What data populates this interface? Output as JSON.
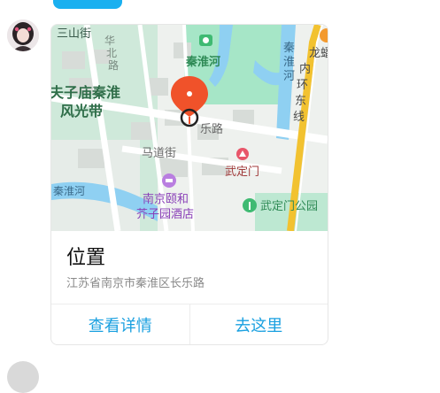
{
  "map": {
    "labels": {
      "sanshanjie": "三山街",
      "huabei": "华",
      "huabei2": "北",
      "huabei3": "路",
      "qinhuaihe_top": "秦淮河",
      "qinhuaihe_right1": "秦",
      "qinhuaihe_right2": "淮",
      "qinhuaihe_right3": "河",
      "huancheng1": "内",
      "huancheng2": "环",
      "huancheng3": "东",
      "huancheng4": "线",
      "longpan": "龙蟠",
      "fuzimiao1": "夫子庙秦淮",
      "fuzimiao2": "风光带",
      "lelu": "乐路",
      "madaojie": "马道街",
      "wudingmen": "武定门",
      "qinhuaihe_left": "秦淮河",
      "hotel1": "南京颐和",
      "hotel2": "芥子园酒店",
      "wudingmen_park": "武定门公园"
    }
  },
  "location": {
    "title": "位置",
    "address": "江苏省南京市秦淮区长乐路"
  },
  "actions": {
    "view_details": "查看详情",
    "go_here": "去这里"
  },
  "colors": {
    "accent": "#1aa0e0",
    "pin": "#f0522a",
    "water": "#8fd0f2",
    "park": "#9fe3c4"
  }
}
